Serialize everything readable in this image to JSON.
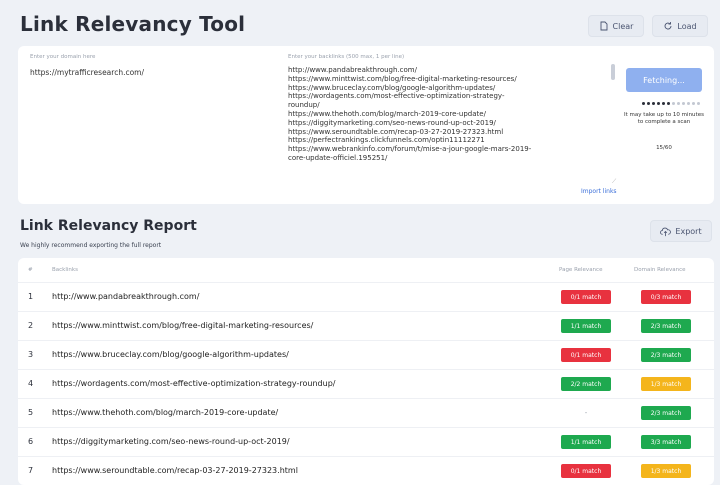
{
  "header": {
    "title": "Link Relevancy Tool",
    "clear_label": "Clear",
    "load_label": "Load"
  },
  "input": {
    "domain_label": "Enter your domain here",
    "domain_value": "https://mytrafficresearch.com/",
    "backlinks_label": "Enter your backlinks (500 max, 1 per line)",
    "backlinks": [
      "http://www.pandabreakthrough.com/",
      "https://www.minttwist.com/blog/free-digital-marketing-resources/",
      "https://www.bruceclay.com/blog/google-algorithm-updates/",
      "https://wordagents.com/most-effective-optimization-strategy-",
      "roundup/",
      "https://www.thehoth.com/blog/march-2019-core-update/",
      "https://diggitymarketing.com/seo-news-round-up-oct-2019/",
      "https://www.seroundtable.com/recap-03-27-2019-27323.html",
      "https://perfectrankings.clickfunnels.com/optin11112271",
      "https://www.webrankinfo.com/forum/t/mise-a-jour-google-mars-2019-",
      "core-update-officiel.195251/"
    ],
    "import_link": "Import links",
    "fetch_label": "Fetching...",
    "wait_note": "It may take up to 10 minutes to complete a scan",
    "progress_text": "15/60",
    "progress_dots_filled": 6,
    "progress_dots_total": 12
  },
  "report": {
    "title": "Link Relevancy Report",
    "subtitle": "We highly recommend exporting the full report",
    "export_label": "Export",
    "columns": [
      "#",
      "Backlinks",
      "Page Relevance",
      "Domain Relevance"
    ],
    "rows": [
      {
        "num": "1",
        "url": "http://www.pandabreakthrough.com/",
        "page": "0/1 match",
        "page_status": "red",
        "domain": "0/3 match",
        "domain_status": "red"
      },
      {
        "num": "2",
        "url": "https://www.minttwist.com/blog/free-digital-marketing-resources/",
        "page": "1/1 match",
        "page_status": "green",
        "domain": "2/3 match",
        "domain_status": "green"
      },
      {
        "num": "3",
        "url": "https://www.bruceclay.com/blog/google-algorithm-updates/",
        "page": "0/1 match",
        "page_status": "red",
        "domain": "2/3 match",
        "domain_status": "green"
      },
      {
        "num": "4",
        "url": "https://wordagents.com/most-effective-optimization-strategy-roundup/",
        "page": "2/2 match",
        "page_status": "green",
        "domain": "1/3 match",
        "domain_status": "yellow"
      },
      {
        "num": "5",
        "url": "https://www.thehoth.com/blog/march-2019-core-update/",
        "page": "-",
        "page_status": "none",
        "domain": "2/3 match",
        "domain_status": "green"
      },
      {
        "num": "6",
        "url": "https://diggitymarketing.com/seo-news-round-up-oct-2019/",
        "page": "1/1 match",
        "page_status": "green",
        "domain": "3/3 match",
        "domain_status": "green"
      },
      {
        "num": "7",
        "url": "https://www.seroundtable.com/recap-03-27-2019-27323.html",
        "page": "0/1 match",
        "page_status": "red",
        "domain": "1/3 match",
        "domain_status": "yellow"
      }
    ]
  },
  "colors": {
    "match_none": "#e8323f",
    "match_full": "#1ea94f",
    "match_partial": "#f4b51c",
    "fetch_button": "#8fb0ef"
  },
  "icons": {
    "clear": "document-icon",
    "load": "refresh-icon",
    "export": "cloud-upload-icon"
  }
}
